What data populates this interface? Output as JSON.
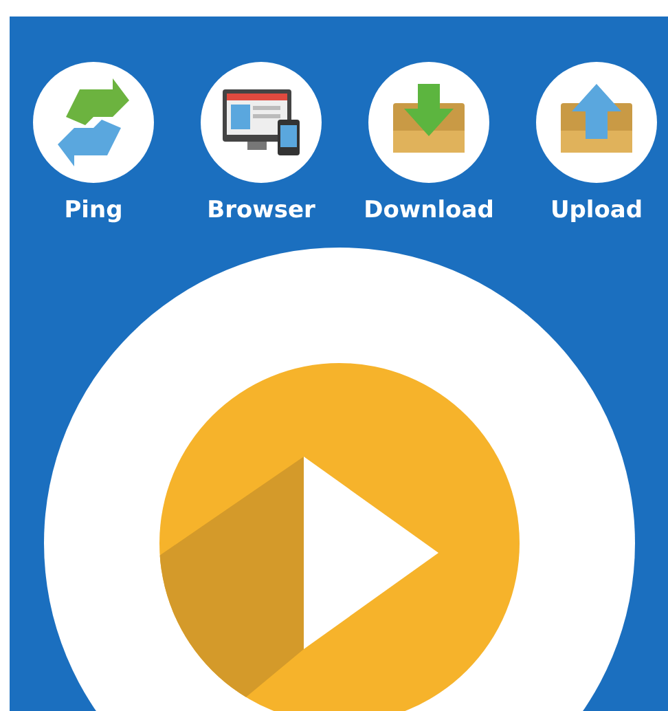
{
  "tools": [
    {
      "kind": "ping",
      "label": "Ping"
    },
    {
      "kind": "browser",
      "label": "Browser"
    },
    {
      "kind": "download",
      "label": "Download"
    },
    {
      "kind": "upload",
      "label": "Upload"
    }
  ],
  "start": {
    "kind": "play"
  }
}
